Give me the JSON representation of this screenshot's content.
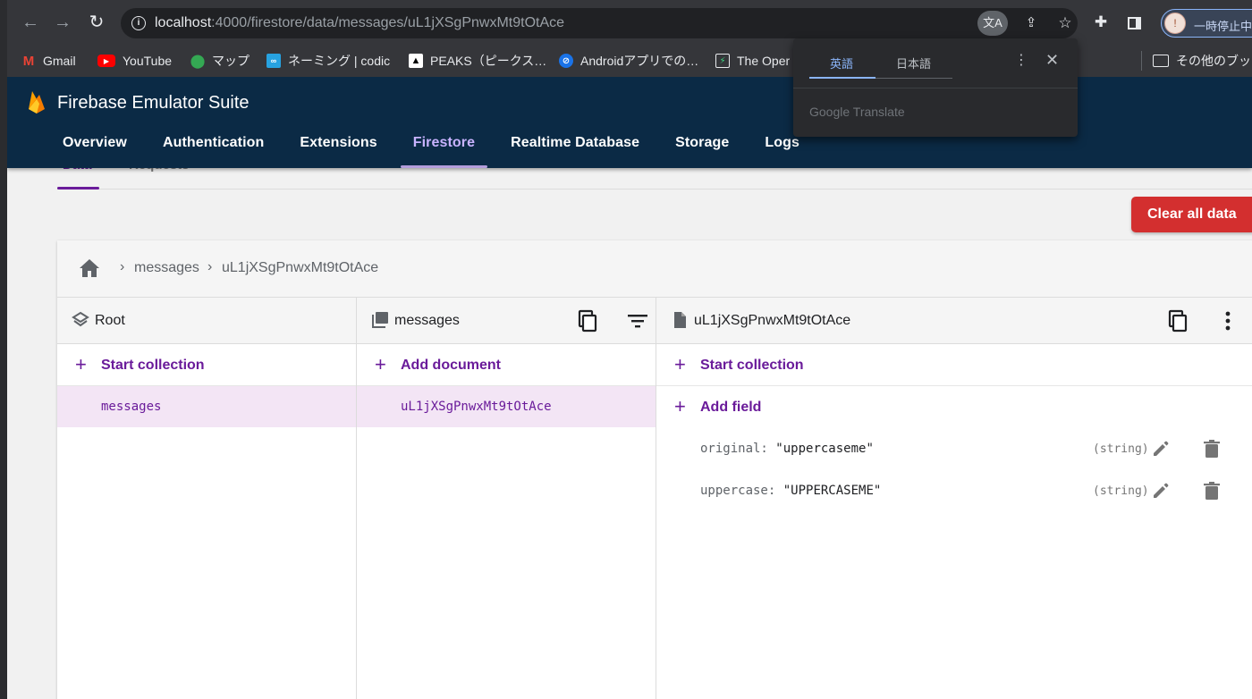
{
  "browser": {
    "url_host": "localhost",
    "url_path": ":4000/firestore/data/messages/uL1jXSgPnwxMt9tOtAce",
    "profile_label": "一時停止中"
  },
  "bookmarks": [
    {
      "label": "Gmail",
      "icon": "gmail-icon"
    },
    {
      "label": "YouTube",
      "icon": "youtube-icon"
    },
    {
      "label": "マップ",
      "icon": "maps-icon"
    },
    {
      "label": "ネーミング | codic",
      "icon": "codic-icon"
    },
    {
      "label": "PEAKS（ピークス…",
      "icon": "peaks-icon"
    },
    {
      "label": "Androidアプリでの…",
      "icon": "android-icon"
    },
    {
      "label": "The Oper",
      "icon": "openapi-icon"
    },
    {
      "label": "その他のブック",
      "icon": "folder-icon"
    }
  ],
  "translate_popup": {
    "tab_active": "英語",
    "tab_inactive": "日本語",
    "brand": "Google Translate"
  },
  "app": {
    "title": "Firebase Emulator Suite",
    "nav": [
      "Overview",
      "Authentication",
      "Extensions",
      "Firestore",
      "Realtime Database",
      "Storage",
      "Logs"
    ],
    "active_nav": "Firestore",
    "subtabs": [
      "Data",
      "Requests"
    ],
    "clear_button": "Clear all data"
  },
  "breadcrumb": [
    "messages",
    "uL1jXSgPnwxMt9tOtAce"
  ],
  "columns": {
    "root": {
      "title": "Root",
      "action": "Start collection",
      "items": [
        "messages"
      ]
    },
    "collection": {
      "title": "messages",
      "action": "Add document",
      "items": [
        "uL1jXSgPnwxMt9tOtAce"
      ]
    },
    "document": {
      "title": "uL1jXSgPnwxMt9tOtAce",
      "action_start": "Start collection",
      "action_add": "Add field",
      "fields": [
        {
          "key": "original:",
          "value": "\"uppercaseme\"",
          "type": "(string)"
        },
        {
          "key": "uppercase:",
          "value": "\"UPPERCASEME\"",
          "type": "(string)"
        }
      ]
    }
  },
  "colors": {
    "header_bg": "#0b2a45",
    "accent_purple": "#6a1b9a",
    "active_nav": "#c9b3ff",
    "danger": "#d32f2f",
    "selected_row": "#f3e5f5"
  }
}
